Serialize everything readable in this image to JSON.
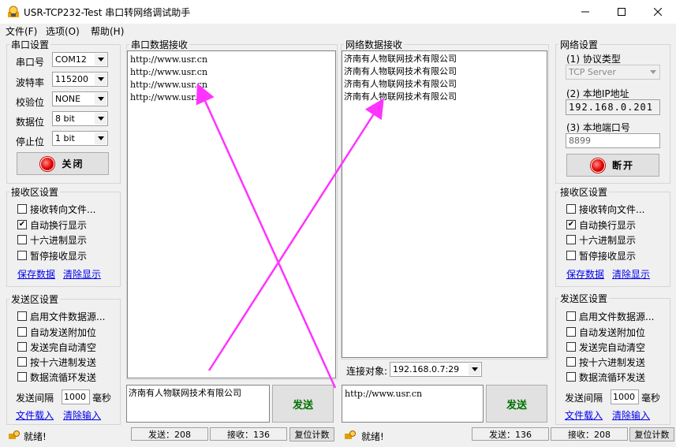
{
  "window": {
    "title": "USR-TCP232-Test 串口转网络调试助手"
  },
  "menu": {
    "file": "文件(F)",
    "options": "选项(O)",
    "help": "帮助(H)"
  },
  "serial_settings": {
    "title": "串口设置",
    "port_label": "串口号",
    "port_value": "COM12",
    "baud_label": "波特率",
    "baud_value": "115200",
    "parity_label": "校验位",
    "parity_value": "NONE",
    "databits_label": "数据位",
    "databits_value": "8 bit",
    "stopbits_label": "停止位",
    "stopbits_value": "1 bit",
    "close_button": "关闭"
  },
  "left_receive": {
    "title": "接收区设置",
    "opt1": "接收转向文件...",
    "opt2": "自动换行显示",
    "opt3": "十六进制显示",
    "opt4": "暂停接收显示",
    "save": "保存数据",
    "clear": "清除显示"
  },
  "left_send": {
    "title": "发送区设置",
    "opt1": "启用文件数据源...",
    "opt2": "自动发送附加位",
    "opt3": "发送完自动清空",
    "opt4": "按十六进制发送",
    "opt5": "数据流循环发送",
    "interval_label": "发送间隔",
    "interval_value": "1000",
    "interval_unit": "毫秒",
    "load": "文件载入",
    "clear": "清除输入"
  },
  "serial_receive": {
    "title": "串口数据接收",
    "lines": [
      "http://www.usr.cn",
      "http://www.usr.cn",
      "http://www.usr.cn",
      "http://www.usr.cn"
    ]
  },
  "serial_send": {
    "text": "济南有人物联网技术有限公司",
    "button": "发送"
  },
  "net_receive": {
    "title": "网络数据接收",
    "lines": [
      "济南有人物联网技术有限公司",
      "济南有人物联网技术有限公司",
      "济南有人物联网技术有限公司",
      "济南有人物联网技术有限公司"
    ]
  },
  "connection": {
    "label": "连接对象:",
    "value": "192.168.0.7:29"
  },
  "net_send": {
    "text": "http://www.usr.cn",
    "button": "发送"
  },
  "net_settings": {
    "title": "网络设置",
    "proto_label": "(1) 协议类型",
    "proto_value": "TCP Server",
    "ip_label": "(2) 本地IP地址",
    "ip_a": "192",
    "ip_b": "168",
    "ip_c": "0",
    "ip_d": "201",
    "port_label": "(3) 本地端口号",
    "port_value": "8899",
    "disconnect_button": "断开"
  },
  "right_receive": {
    "title": "接收区设置",
    "opt1": "接收转向文件...",
    "opt2": "自动换行显示",
    "opt3": "十六进制显示",
    "opt4": "暂停接收显示",
    "save": "保存数据",
    "clear": "清除显示"
  },
  "right_send": {
    "title": "发送区设置",
    "opt1": "启用文件数据源...",
    "opt2": "自动发送附加位",
    "opt3": "发送完自动清空",
    "opt4": "按十六进制发送",
    "opt5": "数据流循环发送",
    "interval_label": "发送间隔",
    "interval_value": "1000",
    "interval_unit": "毫秒",
    "load": "文件载入",
    "clear": "清除输入"
  },
  "status_left": {
    "ready": "就绪!",
    "sent": "发送：208",
    "received": "接收：136",
    "reset": "复位计数"
  },
  "status_right": {
    "ready": "就绪!",
    "sent": "发送：136",
    "received": "接收：208",
    "reset": "复位计数"
  },
  "colors": {
    "arrow": "#ff33ff",
    "send_text": "#007000",
    "link": "#0000ee"
  }
}
